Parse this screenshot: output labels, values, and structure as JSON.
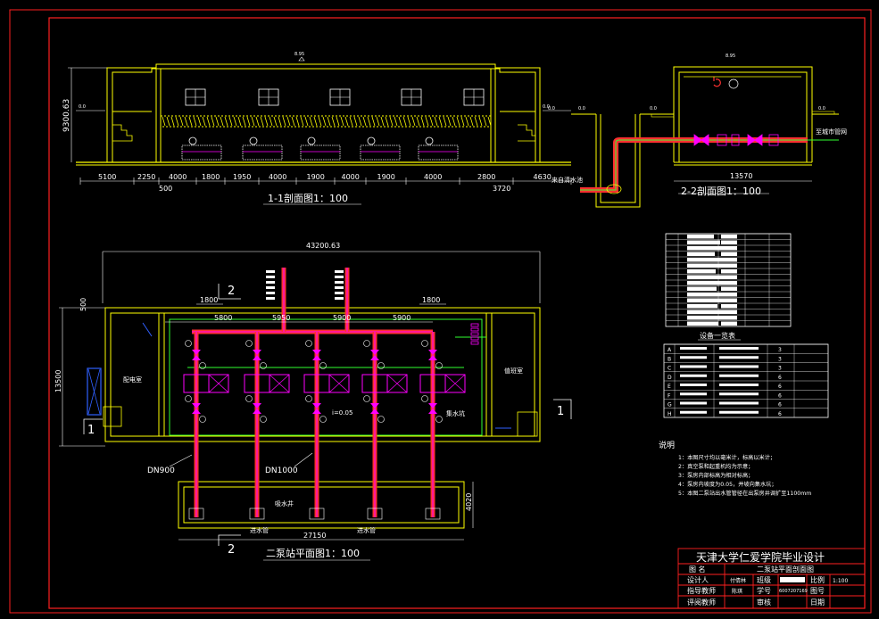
{
  "colors": {
    "background": "#000000",
    "frame": "#ff2020",
    "structure": "#ffff00",
    "pipe": "#ff00ff",
    "pipe_red": "#ff3030",
    "water_line": "#30ff30",
    "dimension": "#ffffff",
    "cyan": "#00ffff",
    "blue": "#3060ff"
  },
  "icons": [
    "window-icon",
    "pump-icon",
    "valve-icon",
    "arrow-icon"
  ],
  "section_1_1": {
    "height_dim": "9300.63",
    "top_level": "8.95",
    "left_level": "0.0",
    "right_level": "0.0",
    "dims": [
      "5100",
      "2250",
      "4000",
      "1800",
      "1950",
      "4000",
      "1900",
      "4000",
      "1900",
      "4000",
      "2800",
      "4630"
    ],
    "sub_dim_left": "500",
    "sub_dim_right": "3720",
    "title": "1-1剖面图1：100"
  },
  "section_2_2": {
    "top_level": "8.95",
    "level_a": "0.0",
    "level_b": "0.0",
    "level_c": "0.0",
    "level_d": "0.0",
    "to_city": "至城市管网",
    "from_pool": "来自清水池",
    "width_dim": "13570",
    "title": "2-2剖面图1：100"
  },
  "plan": {
    "overall_width": "43200.63",
    "height_dim": "13500",
    "left_dim": "500",
    "dims_top": [
      "5800",
      "5950",
      "5900",
      "5900"
    ],
    "short_dims": [
      "1800",
      "1800"
    ],
    "room_left": "配电室",
    "room_right": "值班室",
    "pipe_left": "DN900",
    "pipe_mid": "DN1000",
    "well_label": "吸水井",
    "inlet_left": "进水管",
    "inlet_right": "进水管",
    "drain_label": "集水坑",
    "slope_label": "i=0.05",
    "well_height": "4020",
    "bottom_dim": "27150",
    "marker_section_2": "2",
    "marker_section_1": "1",
    "title": "二泵站平面图1：100"
  },
  "equipment": {
    "title": "设备一览表",
    "table2_codes": [
      "A",
      "B",
      "C",
      "D",
      "E",
      "F",
      "G",
      "H"
    ],
    "table2_qty": [
      "3",
      "3",
      "3",
      "6",
      "6",
      "6",
      "6",
      "6"
    ]
  },
  "notes": {
    "title": "说明",
    "items": [
      "1：本图尺寸均以毫米计，标高以米计；",
      "2：真空泵和起重机均为示意；",
      "3：泵房内部标高为相对标高；",
      "4：泵房内坡度为0.05，并坡向集水坑；",
      "5：本图二泵站出水管管径在出泵房井调扩至1100mm"
    ]
  },
  "title_block": {
    "school": "天津大学仁爱学院毕业设计",
    "drawing_name_label": "图 名",
    "drawing_name": "二泵站平面剖面图",
    "designer_label": "设计人",
    "designer": "付倩林",
    "class_label": "班级",
    "scale_label": "比例",
    "scale": "1:100",
    "advisor_label": "指导教师",
    "advisor": "陈琪",
    "student_no_label": "学号",
    "student_no": "6007207169",
    "drawing_no_label": "图号",
    "reviewer_label": "评阅教师",
    "check_label": "审核",
    "date_label": "日期"
  }
}
